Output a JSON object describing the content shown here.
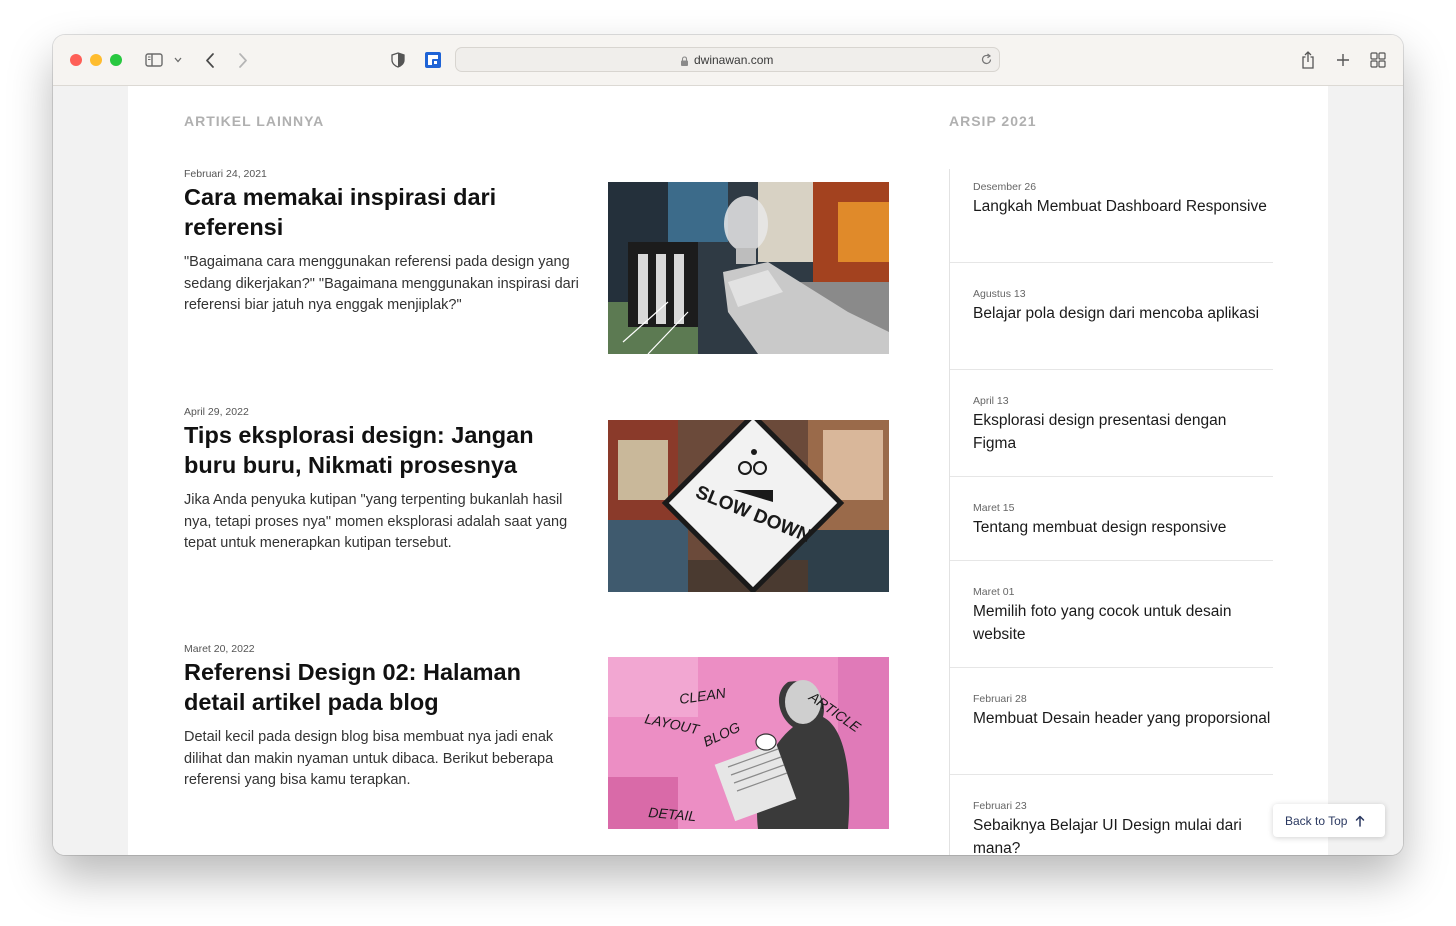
{
  "browser": {
    "url": "dwinawan.com",
    "icons": [
      "sidebar-icon",
      "chevron-down-icon",
      "back-icon",
      "forward-icon",
      "shield-icon",
      "extension-icon",
      "lock-icon",
      "reload-icon",
      "share-icon",
      "new-tab-icon",
      "tab-overview-icon"
    ]
  },
  "main": {
    "section_title": "ARTIKEL LAINNYA",
    "articles": [
      {
        "date": "Februari 24, 2021",
        "title": "Cara memakai inspirasi dari referensi",
        "excerpt": "\"Bagaimana cara menggunakan referensi pada design yang sedang dikerjakan?\" \"Bagaimana menggunakan inspirasi dari referensi biar jatuh nya enggak menjiplak?\"",
        "image": "collage-lightbulb"
      },
      {
        "date": "April 29, 2022",
        "title": "Tips eksplorasi design: Jangan buru buru, Nikmati prosesnya",
        "excerpt": "Jika Anda penyuka kutipan \"yang terpenting bukanlah hasil nya, tetapi proses nya\" momen eksplorasi adalah saat yang tepat untuk menerapkan kutipan tersebut.",
        "image": "collage-slow-down-sign",
        "image_text": "SLOW DOWN"
      },
      {
        "date": "Maret 20, 2022",
        "title": "Referensi Design 02: Halaman detail artikel pada blog",
        "excerpt": "Detail kecil pada design blog bisa membuat nya jadi enak dilihat dan makin nyaman untuk dibaca. Berikut beberapa referensi yang bisa kamu terapkan.",
        "image": "collage-man-reading-newspaper",
        "image_words": [
          "CLEAN",
          "LAYOUT",
          "BLOG",
          "ARTICLE",
          "DETAIL"
        ]
      }
    ]
  },
  "archive": {
    "section_title": "ARSIP 2021",
    "items": [
      {
        "date": "Desember 26",
        "title": "Langkah Membuat Dashboard Responsive"
      },
      {
        "date": "Agustus 13",
        "title": "Belajar pola design dari mencoba aplikasi"
      },
      {
        "date": "April 13",
        "title": "Eksplorasi design presentasi dengan Figma"
      },
      {
        "date": "Maret 15",
        "title": "Tentang membuat design responsive"
      },
      {
        "date": "Maret 01",
        "title": "Memilih foto yang cocok untuk desain website"
      },
      {
        "date": "Februari 28",
        "title": "Membuat Desain header yang proporsional"
      },
      {
        "date": "Februari 23",
        "title": "Sebaiknya Belajar UI Design mulai dari mana?"
      }
    ]
  },
  "back_to_top": {
    "label": "Back to Top",
    "icon": "arrow-up-icon"
  },
  "colors": {
    "accent": "#2a3860",
    "muted_heading": "#b0b0b0"
  }
}
